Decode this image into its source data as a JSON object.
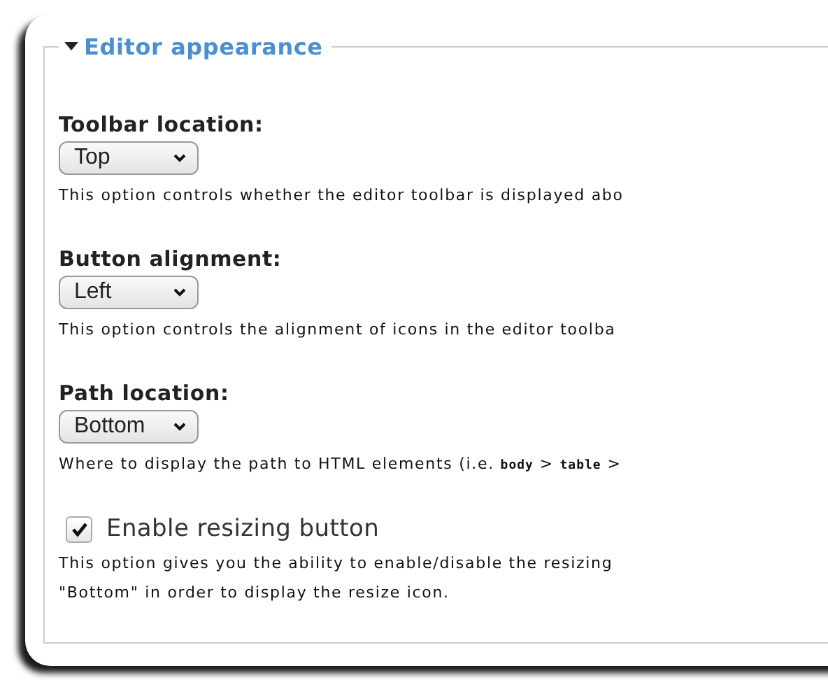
{
  "fieldset": {
    "legend": "Editor appearance",
    "expanded": true,
    "settings": [
      {
        "kind": "select",
        "label": "Toolbar location:",
        "value": "Top",
        "description": [
          {
            "kind": "text",
            "text": "This option controls whether the editor toolbar is displayed abo"
          }
        ]
      },
      {
        "kind": "select",
        "label": "Button alignment:",
        "value": "Left",
        "description": [
          {
            "kind": "text",
            "text": "This option controls the alignment of icons in the editor toolba"
          }
        ]
      },
      {
        "kind": "select",
        "label": "Path location:",
        "value": "Bottom",
        "description": [
          {
            "kind": "text",
            "text": "Where to display the path to HTML elements (i.e. "
          },
          {
            "kind": "code",
            "text": "body"
          },
          {
            "kind": "text",
            "text": " > "
          },
          {
            "kind": "code",
            "text": "table"
          },
          {
            "kind": "text",
            "text": " >"
          }
        ]
      },
      {
        "kind": "checkbox",
        "label": "Enable resizing button",
        "checked": true,
        "description_lines": [
          "This option gives you the ability to enable/disable the resizing",
          "\"Bottom\" in order to display the resize icon."
        ]
      }
    ]
  }
}
